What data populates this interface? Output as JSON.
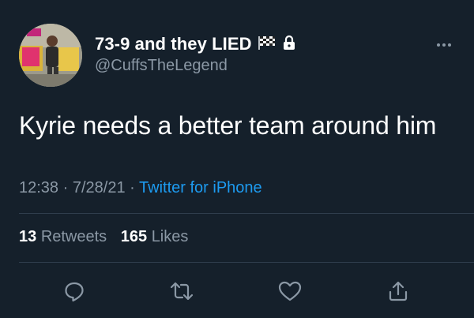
{
  "user": {
    "display_name": "73-9 and they LIED",
    "handle": "@CuffsTheLegend",
    "badges": [
      "checkered-flag-icon",
      "lock-icon"
    ],
    "avatar": "user-avatar-photo"
  },
  "tweet": {
    "text": "Kyrie needs a better team around him",
    "time": "12:38",
    "date": "7/28/21",
    "separator": "·",
    "source": "Twitter for iPhone"
  },
  "stats": {
    "retweets_count": "13",
    "retweets_label": "Retweets",
    "likes_count": "165",
    "likes_label": "Likes"
  },
  "actions": [
    "reply-icon",
    "retweet-icon",
    "like-icon",
    "share-icon"
  ],
  "colors": {
    "background": "#15202b",
    "text": "#ffffff",
    "secondary": "#8b98a5",
    "link": "#1d9bf0",
    "divider": "#2f3d4c"
  }
}
